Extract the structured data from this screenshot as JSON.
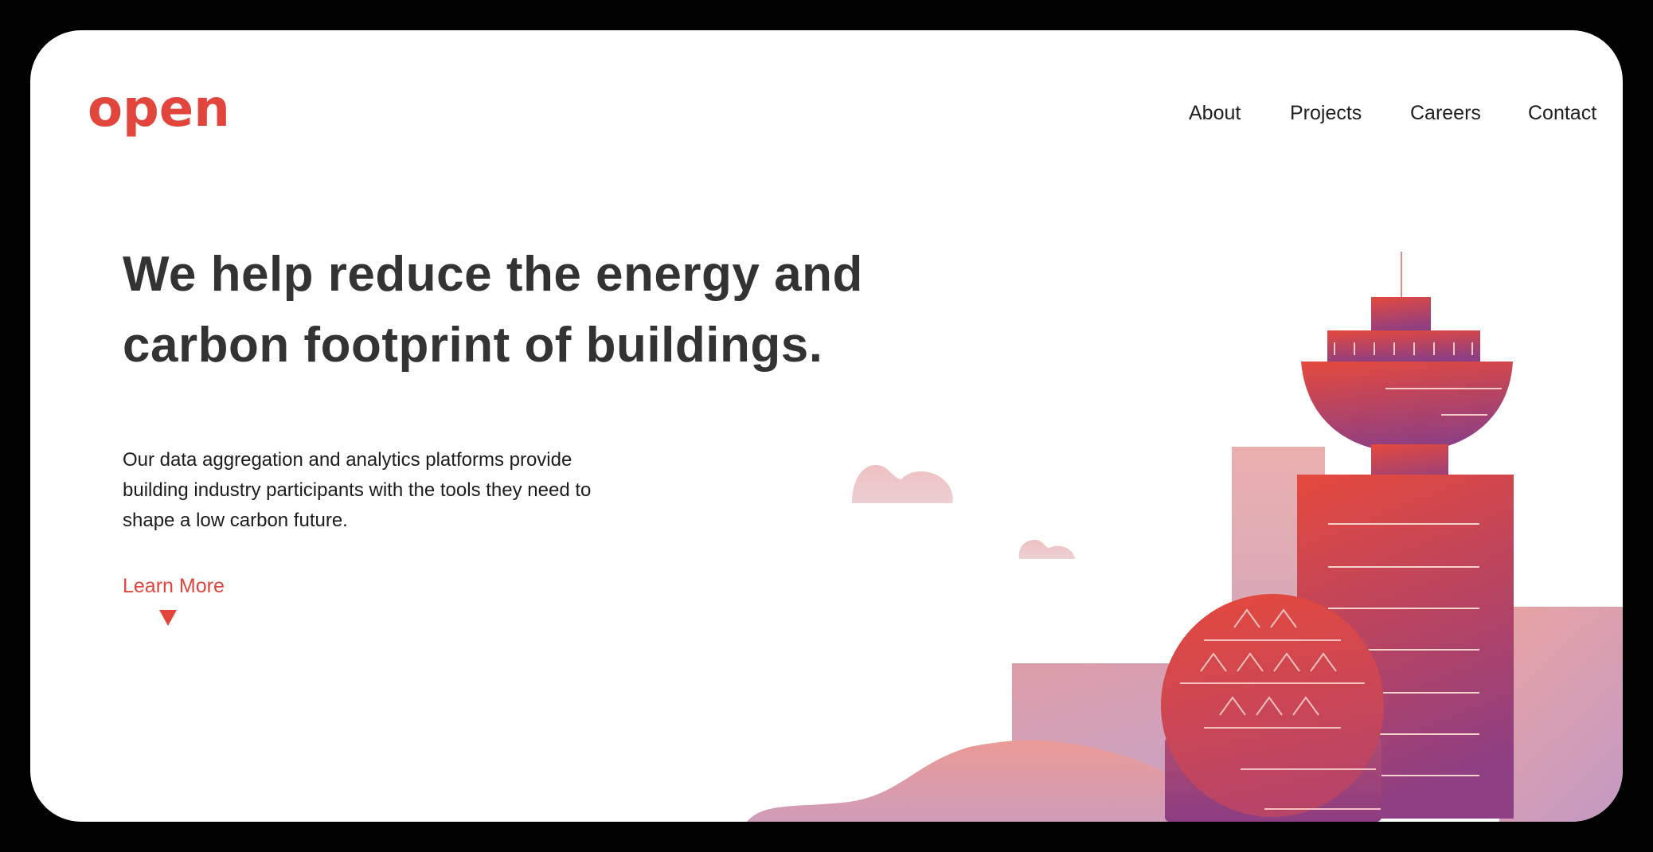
{
  "brand": {
    "logo_text": "open",
    "accent": "#e2453c"
  },
  "nav": {
    "items": [
      {
        "label": "About"
      },
      {
        "label": "Projects"
      },
      {
        "label": "Careers"
      },
      {
        "label": "Contact"
      }
    ]
  },
  "hero": {
    "headline_line1": "We help reduce the energy and",
    "headline_line2": "carbon footprint of buildings.",
    "description_line1": "Our data aggregation and analytics platforms provide",
    "description_line2": "building industry participants with the tools they need to",
    "description_line3": "shape a low carbon future.",
    "cta_label": "Learn More",
    "cta_icon": "triangle-down-icon"
  },
  "illustration": {
    "subject": "city-skyline",
    "colors": {
      "red": "#e5493c",
      "purple": "#8f3f83",
      "pale_pink": "#eab0b0",
      "lavender": "#c79ac0",
      "cloud": "#efc7ca"
    }
  }
}
